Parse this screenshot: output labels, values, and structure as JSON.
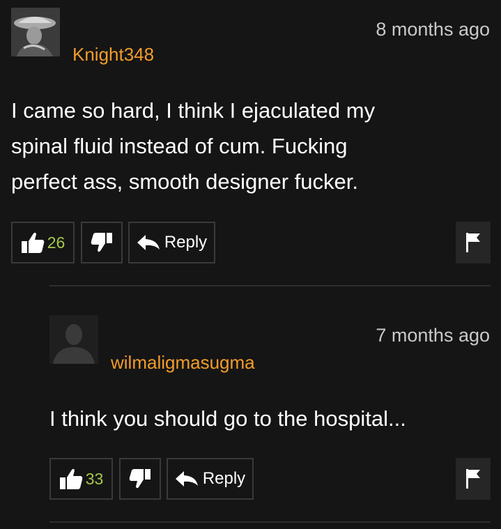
{
  "comments": [
    {
      "username": "Knight348",
      "timestamp": "8 months ago",
      "lines": [
        "I came so hard, I think I ejaculated my",
        "spinal fluid instead of cum. Fucking",
        "perfect ass, smooth designer fucker."
      ],
      "likes": "26",
      "reply_label": "Reply",
      "icons": {
        "like": "thumbs-up-icon",
        "dislike": "thumbs-down-icon",
        "reply": "reply-arrow-icon",
        "flag": "flag-icon"
      }
    },
    {
      "username": "wilmaligmasugma",
      "timestamp": "7 months ago",
      "lines": [
        "I think you should go to the hospital..."
      ],
      "likes": "33",
      "reply_label": "Reply",
      "icons": {
        "like": "thumbs-up-icon",
        "dislike": "thumbs-down-icon",
        "reply": "reply-arrow-icon",
        "flag": "flag-icon"
      }
    }
  ],
  "colors": {
    "background": "#151515",
    "username": "#f29c2a",
    "like_count": "#a5c84a",
    "timestamp": "#c9c9c9",
    "button_border": "#3a3a3a",
    "flag_bg": "#262626"
  }
}
